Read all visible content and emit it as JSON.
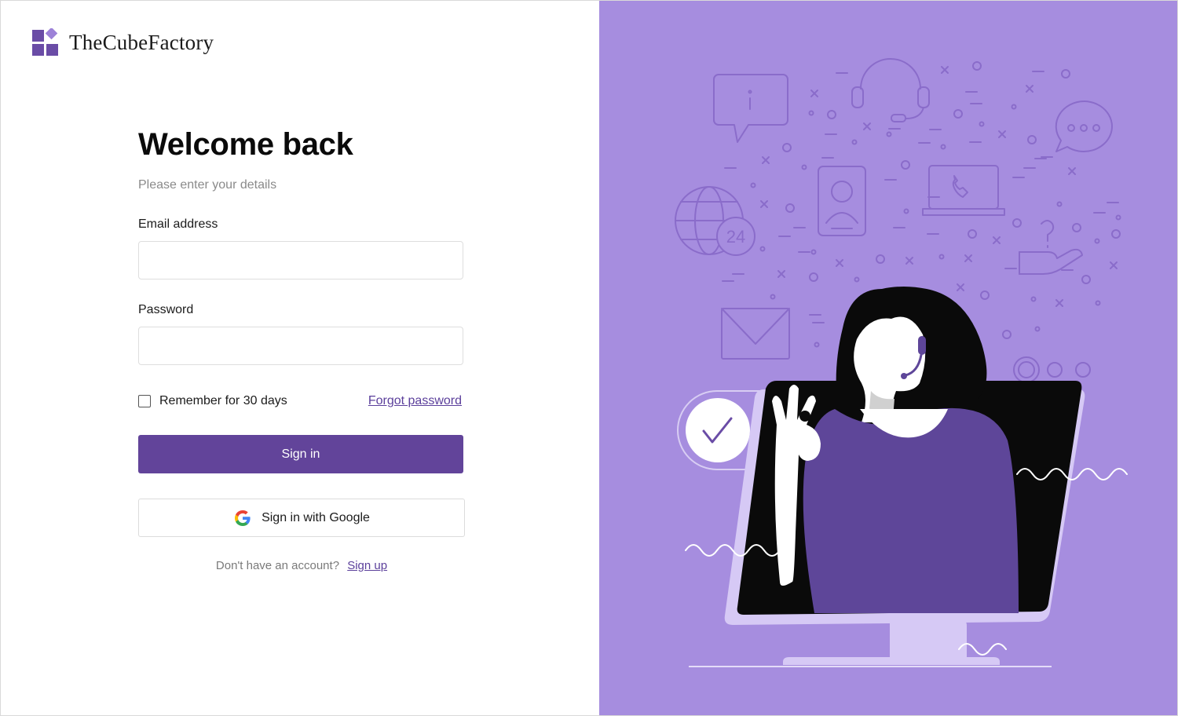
{
  "brand": {
    "name": "TheCubeFactory",
    "logo_icon": "cube-logo-icon"
  },
  "login": {
    "title": "Welcome back",
    "subtitle": "Please enter your details",
    "email_label": "Email address",
    "email_value": "",
    "password_label": "Password",
    "password_value": "",
    "remember_label": "Remember for 30 days",
    "remember_checked": false,
    "forgot_label": "Forgot password",
    "signin_label": "Sign in",
    "google_label": "Sign in with Google",
    "google_icon": "google-icon",
    "no_account_text": "Don't have an account?",
    "signup_label": "Sign up"
  },
  "illustration": {
    "badge_text": "24"
  },
  "colors": {
    "accent": "#62449a",
    "panel": "#a68ddf",
    "line": "#8a6cca",
    "link": "#5b3f9b",
    "shirt": "#5e4699",
    "screen_frame": "#d6c9f5"
  }
}
